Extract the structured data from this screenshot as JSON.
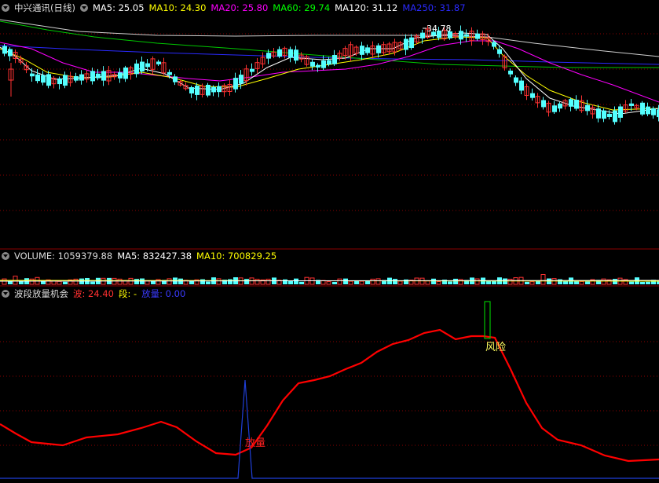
{
  "main_chart": {
    "title": "中兴通讯(日线)",
    "ma_labels": [
      {
        "text": "MA5: 25.05",
        "color": "#ffffff"
      },
      {
        "text": "MA10: 24.30",
        "color": "#ffff00"
      },
      {
        "text": "MA20: 25.80",
        "color": "#ff00ff"
      },
      {
        "text": "MA60: 29.74",
        "color": "#00ff00"
      },
      {
        "text": "MA120: 31.12",
        "color": "#ffffff"
      },
      {
        "text": "MA250: 31.87",
        "color": "#2a2aff"
      }
    ],
    "high_label": "34.78"
  },
  "volume_panel": {
    "title": "VOLUME: 1059379.88",
    "ma5": "MA5: 832427.38",
    "ma10": "MA10: 700829.25"
  },
  "indicator_panel": {
    "title": "波段放量机会",
    "wave_label": "波: 24.40",
    "segment_label": "段: -",
    "volume_label": "放量: 0.00",
    "signal_volume": "放量",
    "signal_risk": "风险"
  },
  "colors": {
    "up": "#ff3232",
    "down": "#54ffff",
    "grid": "#8b0000",
    "wave_line": "#ff0000",
    "volume_line": "#1f3fd8",
    "risk_bar": "#00c000"
  },
  "chart_data": [
    {
      "type": "candlestick",
      "title": "中兴通讯(日线)",
      "series": [
        {
          "name": "MA5",
          "last": 25.05
        },
        {
          "name": "MA10",
          "last": 24.3
        },
        {
          "name": "MA20",
          "last": 25.8
        },
        {
          "name": "MA60",
          "last": 29.74
        },
        {
          "name": "MA120",
          "last": 31.12
        },
        {
          "name": "MA250",
          "last": 31.87
        }
      ],
      "annotations": [
        "34.78"
      ]
    },
    {
      "type": "bar",
      "title": "VOLUME: 1059379.88",
      "series": [
        {
          "name": "MA5",
          "last": 832427.38
        },
        {
          "name": "MA10",
          "last": 700829.25
        }
      ]
    },
    {
      "type": "line",
      "title": "波段放量机会",
      "series": [
        {
          "name": "波",
          "last": 24.4
        },
        {
          "name": "段",
          "last": "-"
        },
        {
          "name": "放量",
          "last": 0.0
        }
      ],
      "annotations": [
        "放量",
        "风险"
      ]
    }
  ]
}
